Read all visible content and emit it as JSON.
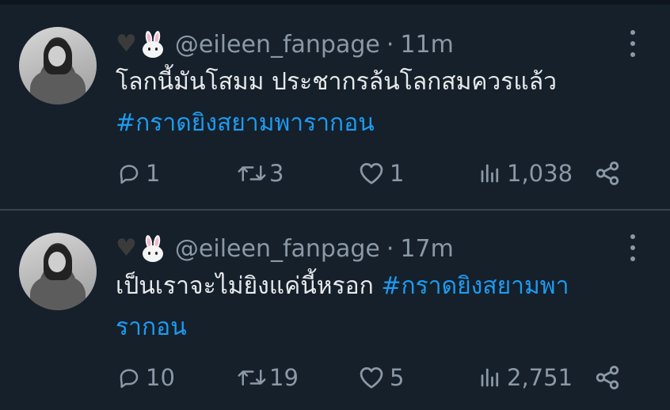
{
  "tweets": [
    {
      "handle": "@eileen_fanpage",
      "separator": "·",
      "time": "11m",
      "text": "โลกนี้มันโสมม ประชากรล้นโลกสมควรแล้ว",
      "hashtag": "#กราดยิงสยามพารากอน",
      "replies": "1",
      "retweets": "3",
      "likes": "1",
      "views": "1,038"
    },
    {
      "handle": "@eileen_fanpage",
      "separator": "·",
      "time": "17m",
      "text": "เป็นเราจะไม่ยิงแค่นี้หรอก",
      "hashtag": "#กราดยิงสยามพา",
      "hashtag_cont": "รากอน",
      "replies": "10",
      "retweets": "19",
      "likes": "5",
      "views": "2,751"
    }
  ],
  "icons": {
    "heart_emoji": "black-heart-emoji",
    "bunny_emoji": "rabbit-face-emoji",
    "reply": "reply-icon",
    "retweet": "retweet-icon",
    "like": "heart-icon",
    "views": "views-icon",
    "share": "share-icon",
    "more": "more-icon"
  },
  "colors": {
    "background": "#15202b",
    "text": "#e7e9ea",
    "secondary": "#8b98a5",
    "accent": "#1d9bf0",
    "divider": "#38444d"
  }
}
